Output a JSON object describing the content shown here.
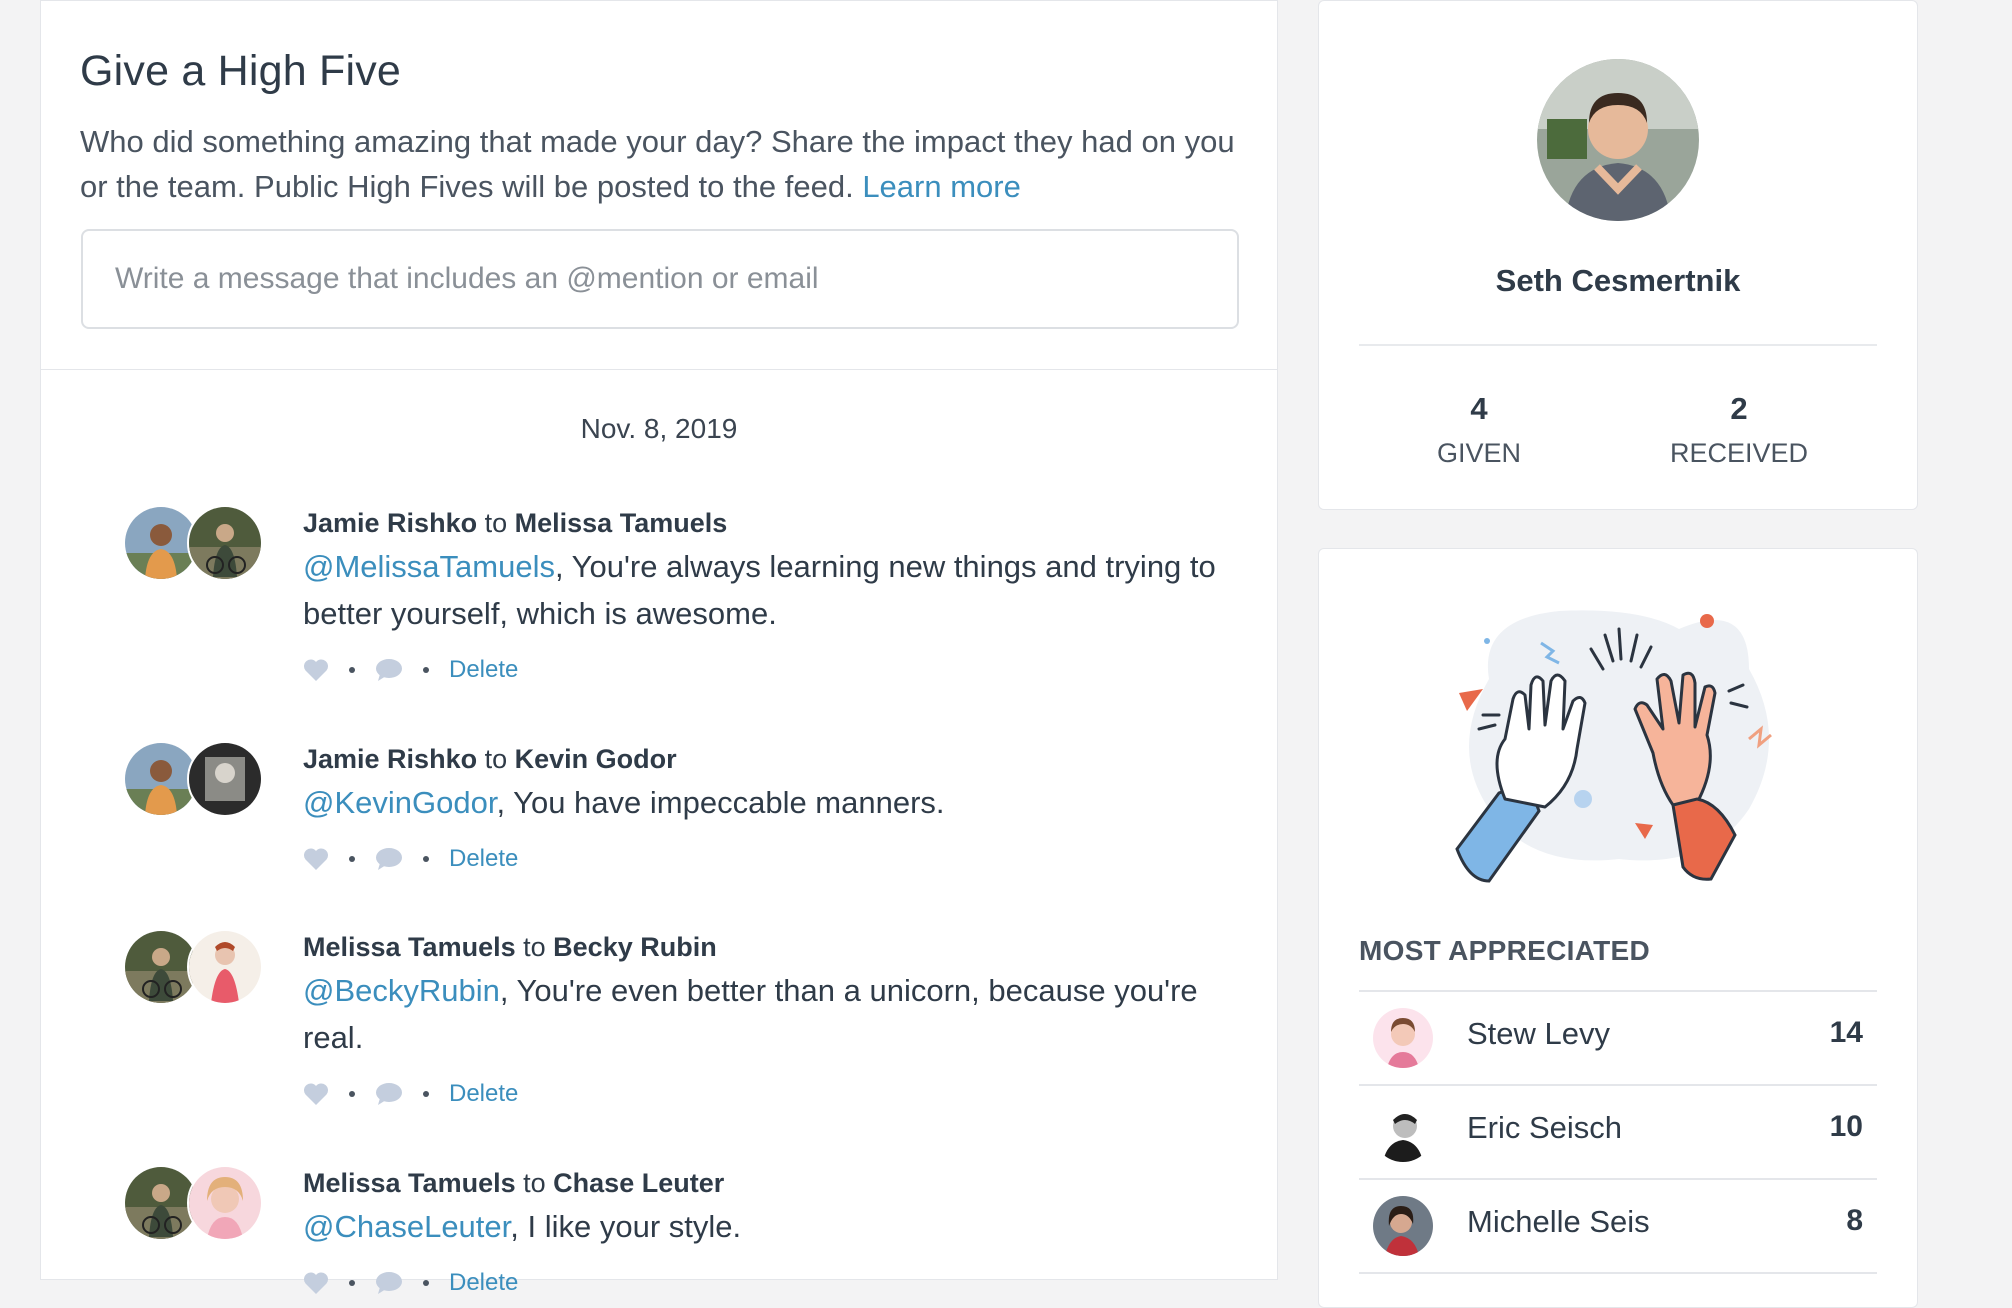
{
  "compose": {
    "title": "Give a High Five",
    "description": "Who did something amazing that made your day? Share the impact they had on you or the team. Public High Fives will be posted to the feed.",
    "learn_more": "Learn more",
    "placeholder": "Write a message that includes an @mention or email"
  },
  "feed": {
    "date": "Nov. 8, 2019",
    "items": [
      {
        "from": "Jamie Rishko",
        "connector": "to",
        "to": "Melissa Tamuels",
        "mention": "@MelissaTamuels",
        "text": ", You're always learning new things and trying to better yourself, which is awesome.",
        "delete": "Delete"
      },
      {
        "from": "Jamie Rishko",
        "connector": "to",
        "to": "Kevin Godor",
        "mention": "@KevinGodor",
        "text": ", You have impeccable manners.",
        "delete": "Delete"
      },
      {
        "from": "Melissa Tamuels",
        "connector": "to",
        "to": "Becky Rubin",
        "mention": "@BeckyRubin",
        "text": ", You're even better than a unicorn, because you're real.",
        "delete": "Delete"
      },
      {
        "from": "Melissa Tamuels",
        "connector": "to",
        "to": "Chase Leuter",
        "mention": "@ChaseLeuter",
        "text": ", I like your style.",
        "delete": "Delete"
      }
    ]
  },
  "profile": {
    "name": "Seth Cesmertnik",
    "given_count": "4",
    "given_label": "GIVEN",
    "received_count": "2",
    "received_label": "RECEIVED"
  },
  "most_appreciated": {
    "heading": "MOST APPRECIATED",
    "people": [
      {
        "name": "Stew Levy",
        "count": "14"
      },
      {
        "name": "Eric Seisch",
        "count": "10"
      },
      {
        "name": "Michelle Seis",
        "count": "8"
      }
    ]
  },
  "colors": {
    "link": "#3b8ebd",
    "text": "#2f3b48",
    "accent_orange": "#e8694a",
    "accent_blue": "#7fb6e6"
  },
  "icons": [
    "heart-icon",
    "comment-icon"
  ]
}
